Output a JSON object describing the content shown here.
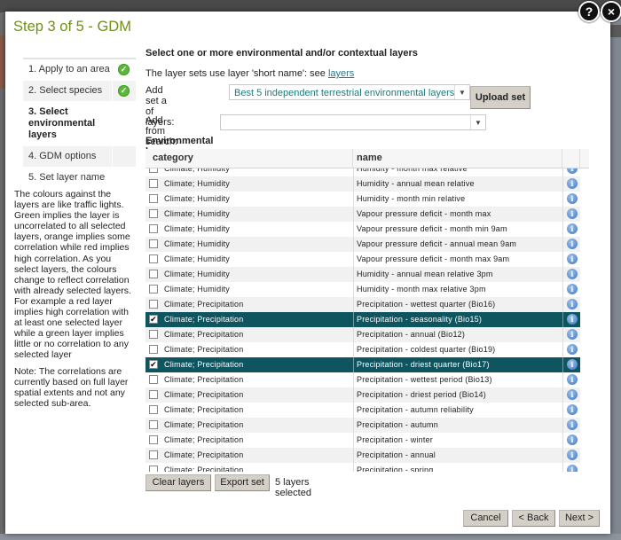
{
  "dialog": {
    "title": "Step 3 of 5 - GDM",
    "help_icon": "?",
    "close_icon": "×"
  },
  "steps": [
    {
      "label": "1. Apply to an area",
      "done": true
    },
    {
      "label": "2. Select species",
      "done": true
    },
    {
      "label": "3. Select environmental layers",
      "done": false,
      "current": true
    },
    {
      "label": "4. GDM options",
      "done": false
    },
    {
      "label": "5. Set layer name",
      "done": false
    }
  ],
  "help": {
    "p1": "The colours against the layers are like traffic lights. Green implies the layer is uncorrelated to all selected layers, orange implies some correlation while red implies high correlation. As you select layers, the colours change to reflect correlation with already selected layers. For example a red layer implies high correlation with at least one selected layer while a green layer implies little or no correlation to any selected layer",
    "p2": "Note: The correlations are currently based on full layer spatial extents and not any selected sub-area."
  },
  "main": {
    "heading": "Select one or more environmental and/or contextual layers",
    "note_prefix": "The layer sets use layer 'short name': see ",
    "note_link": "layers",
    "add_set_label": "Add set a of layers:",
    "add_set_value": "Best 5 independent terrestrial environmental layers",
    "upload_set": "Upload set",
    "add_search_label": "Add from search:",
    "add_search_value": "",
    "env_title": "Environmental layers",
    "columns": {
      "category": "category",
      "name": "name"
    },
    "clear_layers": "Clear layers",
    "export_set": "Export set",
    "selected_count": "5 layers selected"
  },
  "colors": {
    "yellow": "#ffff00",
    "red": "#c0201f",
    "selected_row": "#0f5560",
    "title_green": "#6f8f1c"
  },
  "rows": [
    {
      "category": "Climate; Humidity",
      "name": "Humidity - month max relative",
      "checked": false,
      "corr": "yellow"
    },
    {
      "category": "Climate; Humidity",
      "name": "Humidity - annual mean relative",
      "checked": false,
      "corr": "yellow"
    },
    {
      "category": "Climate; Humidity",
      "name": "Humidity - month min relative",
      "checked": false,
      "corr": "yellow"
    },
    {
      "category": "Climate; Humidity",
      "name": "Vapour pressure deficit - month max",
      "checked": false,
      "corr": "yellow"
    },
    {
      "category": "Climate; Humidity",
      "name": "Vapour pressure deficit - month min 9am",
      "checked": false,
      "corr": "yellow"
    },
    {
      "category": "Climate; Humidity",
      "name": "Vapour pressure deficit - annual mean 9am",
      "checked": false,
      "corr": "yellow"
    },
    {
      "category": "Climate; Humidity",
      "name": "Vapour pressure deficit - month max 9am",
      "checked": false,
      "corr": "yellow"
    },
    {
      "category": "Climate; Humidity",
      "name": "Humidity - annual mean relative 3pm",
      "checked": false,
      "corr": "yellow"
    },
    {
      "category": "Climate; Humidity",
      "name": "Humidity - month max relative 3pm",
      "checked": false,
      "corr": "yellow"
    },
    {
      "category": "Climate; Precipitation",
      "name": "Precipitation - wettest quarter (Bio16)",
      "checked": false,
      "corr": "red"
    },
    {
      "category": "Climate; Precipitation",
      "name": "Precipitation - seasonality (Bio15)",
      "checked": true,
      "corr": "red"
    },
    {
      "category": "Climate; Precipitation",
      "name": "Precipitation - annual (Bio12)",
      "checked": false,
      "corr": "red"
    },
    {
      "category": "Climate; Precipitation",
      "name": "Precipitation - coldest quarter (Bio19)",
      "checked": false,
      "corr": "red"
    },
    {
      "category": "Climate; Precipitation",
      "name": "Precipitation - driest quarter (Bio17)",
      "checked": true,
      "corr": "red"
    },
    {
      "category": "Climate; Precipitation",
      "name": "Precipitation - wettest period (Bio13)",
      "checked": false,
      "corr": "red"
    },
    {
      "category": "Climate; Precipitation",
      "name": "Precipitation - driest period (Bio14)",
      "checked": false,
      "corr": "red"
    },
    {
      "category": "Climate; Precipitation",
      "name": "Precipitation - autumn reliability",
      "checked": false,
      "corr": "yellow"
    },
    {
      "category": "Climate; Precipitation",
      "name": "Precipitation - autumn",
      "checked": false,
      "corr": "red"
    },
    {
      "category": "Climate; Precipitation",
      "name": "Precipitation - winter",
      "checked": false,
      "corr": "red"
    },
    {
      "category": "Climate; Precipitation",
      "name": "Precipitation - annual",
      "checked": false,
      "corr": "red"
    },
    {
      "category": "Climate; Precipitation",
      "name": "Precipitation - spring",
      "checked": false,
      "corr": "red"
    }
  ],
  "footer": {
    "cancel": "Cancel",
    "back": "< Back",
    "next": "Next >"
  }
}
